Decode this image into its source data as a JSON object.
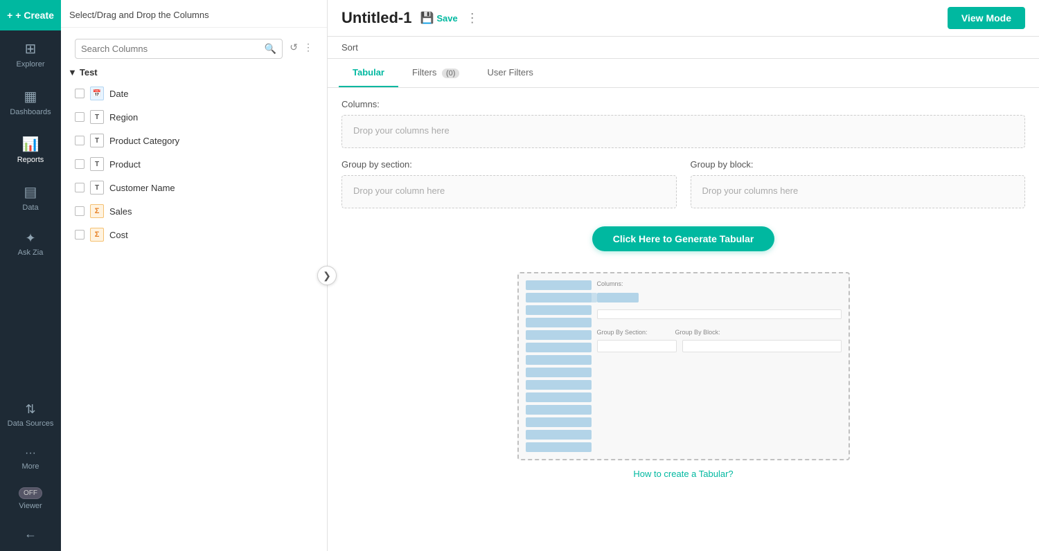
{
  "app": {
    "create_label": "+ Create",
    "view_mode_label": "View Mode"
  },
  "nav": {
    "items": [
      {
        "id": "explorer",
        "label": "Explorer",
        "icon": "⊞"
      },
      {
        "id": "dashboards",
        "label": "Dashboards",
        "icon": "▦"
      },
      {
        "id": "reports",
        "label": "Reports",
        "icon": "📊"
      },
      {
        "id": "data",
        "label": "Data",
        "icon": "▤"
      },
      {
        "id": "ask-zia",
        "label": "Ask Zia",
        "icon": "✦"
      },
      {
        "id": "data-sources",
        "label": "Data Sources",
        "icon": "⇅"
      },
      {
        "id": "more",
        "label": "More",
        "icon": "···"
      }
    ],
    "viewer_label": "Viewer",
    "viewer_toggle": "OFF",
    "back_icon": "←"
  },
  "column_panel": {
    "header": "Select/Drag and Drop the Columns",
    "search_placeholder": "Search Columns",
    "group_name": "Test",
    "columns": [
      {
        "name": "Date",
        "type": "date",
        "type_label": "📅"
      },
      {
        "name": "Region",
        "type": "text",
        "type_label": "T"
      },
      {
        "name": "Product Category",
        "type": "text",
        "type_label": "T"
      },
      {
        "name": "Product",
        "type": "text",
        "type_label": "T"
      },
      {
        "name": "Customer Name",
        "type": "text",
        "type_label": "T"
      },
      {
        "name": "Sales",
        "type": "num",
        "type_label": "#"
      },
      {
        "name": "Cost",
        "type": "num",
        "type_label": "#"
      }
    ]
  },
  "report": {
    "title": "Untitled-1",
    "save_label": "Save",
    "sort_label": "Sort",
    "tabs": [
      {
        "id": "tabular",
        "label": "Tabular",
        "badge": null
      },
      {
        "id": "filters",
        "label": "Filters",
        "badge": "(0)"
      },
      {
        "id": "user-filters",
        "label": "User Filters",
        "badge": null
      }
    ],
    "columns_label": "Columns:",
    "columns_drop_placeholder": "Drop your columns here",
    "group_section_label": "",
    "group_by_section_label": "Group by section:",
    "group_by_section_placeholder": "Drop your column here",
    "group_by_block_label": "Group by block:",
    "group_by_block_placeholder": "Drop your columns here",
    "generate_btn_label": "Click Here to Generate Tabular",
    "how_to_link": "How to create a Tabular?"
  }
}
